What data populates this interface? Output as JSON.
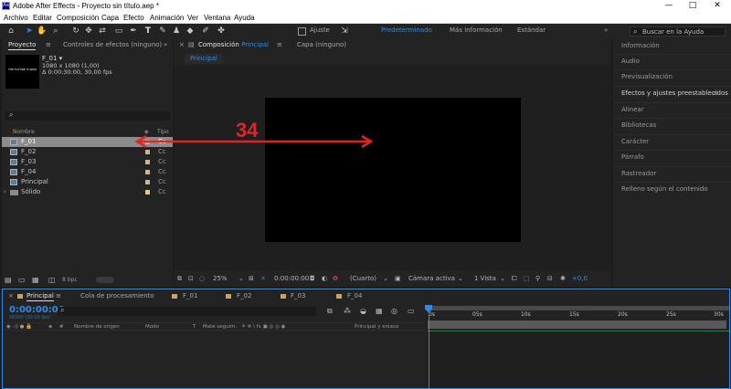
{
  "titlebar": {
    "title": "Adobe After Effects - Proyecto sin título.aep *",
    "logo": "Ae",
    "minimize": "—",
    "maximize": "□",
    "close": "✕"
  },
  "menu": [
    "Archivo",
    "Editar",
    "Composición",
    "Capa",
    "Efecto",
    "Animación",
    "Ver",
    "Ventana",
    "Ayuda"
  ],
  "toolbar": {
    "snap_label": "Ajuste",
    "workspaces": [
      "Predeterminado",
      "Más información",
      "Estándar"
    ],
    "overflow": "»",
    "search_placeholder": "Buscar en la Ayuda"
  },
  "project_panel": {
    "tabs": [
      "Proyecto",
      "Controles de efectos (ninguno)"
    ],
    "overflow": "»",
    "menu": "≡",
    "selected_item": {
      "name": "F_01 ▾",
      "dimensions": "1080 x 1080 (1,00)",
      "duration": "Δ 0:00:30:00, 30,00 fps"
    },
    "thumb_text": "THE FUTURE IS NOW",
    "columns": {
      "name": "Nombre",
      "type": "Tipo"
    },
    "items": [
      {
        "name": "F_01",
        "type": "Cc",
        "selected": true
      },
      {
        "name": "F_02",
        "type": "Cc",
        "selected": false
      },
      {
        "name": "F_03",
        "type": "Cc",
        "selected": false
      },
      {
        "name": "F_04",
        "type": "Cc",
        "selected": false
      },
      {
        "name": "Principal",
        "type": "Cc",
        "selected": false
      },
      {
        "name": "Sólido",
        "type": "Cc",
        "selected": false
      }
    ],
    "footer_bpc": "8 bpc"
  },
  "comp_panel": {
    "tab_prefix": "Composición",
    "tab_name": "Principal",
    "tab_menu": "≡",
    "layer_tab": "Capa (ninguno)",
    "breadcrumb": "Principal",
    "annotation_number": "34",
    "footer": {
      "zoom": "25%",
      "timecode": "0:00:00:00",
      "resolution": "(Cuarto)",
      "camera": "Cámara activa",
      "views": "1 Vista",
      "exposure": "+0,0"
    }
  },
  "right_panel": {
    "items": [
      "Información",
      "Audio",
      "Previsualización",
      "Efectos y ajustes preestablecidos",
      "Alinear",
      "Bibliotecas",
      "Carácter",
      "Párrafo",
      "Rastreador",
      "Relleno según el contenido"
    ],
    "active_index": 3,
    "menu": "≡"
  },
  "timeline": {
    "tabs": [
      {
        "name": "Principal",
        "active": true
      },
      {
        "name": "Cola de procesamiento",
        "active": false
      },
      {
        "name": "F_01",
        "active": false
      },
      {
        "name": "F_02",
        "active": false
      },
      {
        "name": "F_03",
        "active": false
      },
      {
        "name": "F_04",
        "active": false
      }
    ],
    "timecode": "0:00:00:00",
    "timecode_sub": "00000 (30.00 fps)",
    "columns": {
      "source": "Nombre de origen",
      "mode": "Modo",
      "t": "T",
      "matte": "Mate seguim.",
      "switches": "⚘ ✲ \\ fx ▣ ◎ ◎ ◉",
      "parent": "Principal y enlace"
    },
    "ruler": [
      "0s",
      "05s",
      "10s",
      "15s",
      "20s",
      "25s",
      "30s"
    ]
  },
  "colors": {
    "accent": "#2d8ceb",
    "annotation": "#e0242a",
    "label": "#d2b48c",
    "panel": "#232323"
  }
}
